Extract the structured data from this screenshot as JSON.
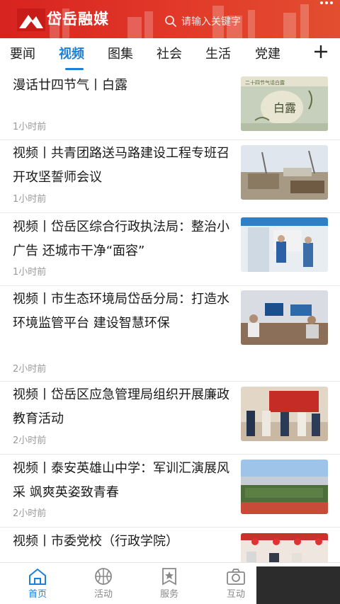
{
  "header": {
    "brand": "岱岳融媒",
    "search_placeholder": "请输入关键字",
    "colors": {
      "header_start": "#d8231f",
      "header_end": "#e24e2f",
      "accent": "#1e7fd6"
    }
  },
  "tabs": [
    {
      "label": "要闻",
      "active": false
    },
    {
      "label": "视频",
      "active": true
    },
    {
      "label": "图集",
      "active": false
    },
    {
      "label": "社会",
      "active": false
    },
    {
      "label": "生活",
      "active": false
    },
    {
      "label": "党建",
      "active": false
    }
  ],
  "news": [
    {
      "title": "漫话廿四节气丨白露",
      "time": "1小时前"
    },
    {
      "title": "视频丨共青团路送马路建设工程专班召开攻坚誓师会议",
      "time": "1小时前"
    },
    {
      "title": "视频丨岱岳区综合行政执法局：整治小广告 还城市干净“面容”",
      "time": "1小时前"
    },
    {
      "title": "视频丨市生态环境局岱岳分局：打造水环境监管平台 建设智慧环保",
      "time": "2小时前"
    },
    {
      "title": "视频丨岱岳区应急管理局组织开展廉政教育活动",
      "time": "2小时前"
    },
    {
      "title": "视频丨泰安英雄山中学：军训汇演展风采 飒爽英姿致青春",
      "time": "2小时前"
    },
    {
      "title": "视频丨市委党校（行政学院）",
      "time": ""
    }
  ],
  "thumb_texts": {
    "solar_term": "白露",
    "solar_banner": "二十四节气话白露"
  },
  "bottom_nav": [
    {
      "label": "首页",
      "icon": "home-icon",
      "active": true
    },
    {
      "label": "活动",
      "icon": "basketball-icon",
      "active": false
    },
    {
      "label": "服务",
      "icon": "star-badge-icon",
      "active": false
    },
    {
      "label": "互动",
      "icon": "camera-icon",
      "active": false
    }
  ]
}
